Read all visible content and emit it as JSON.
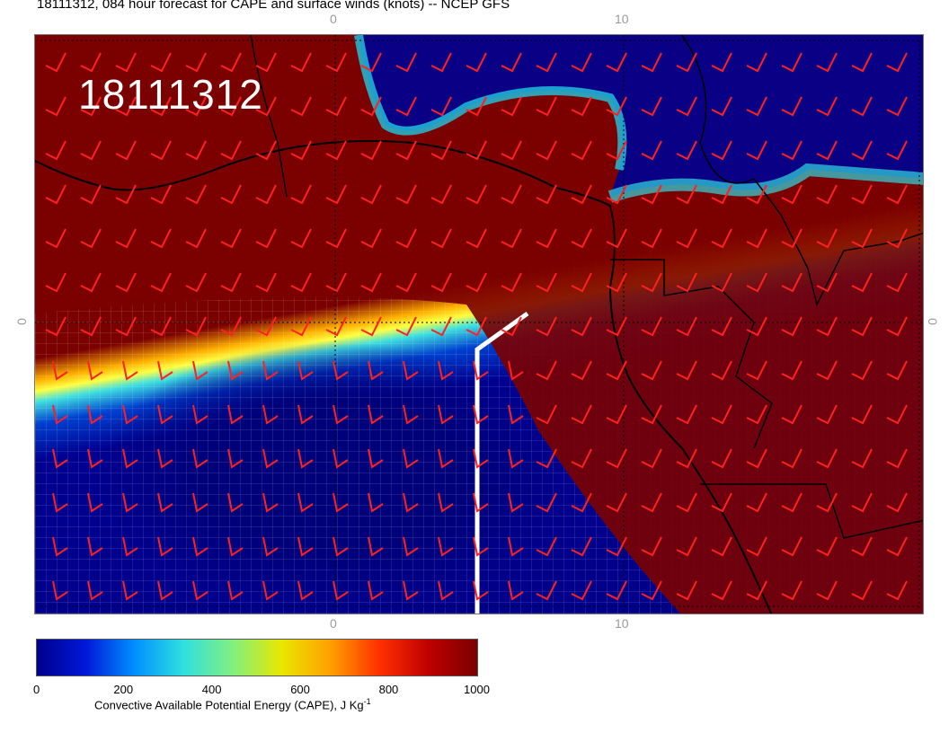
{
  "title": "18111312, 084 hour forecast for CAPE and surface winds (knots) -- NCEP GFS",
  "map": {
    "timestamp": "18111312",
    "tick_top_left": "0",
    "tick_top_right": "10",
    "tick_bottom_left": "0",
    "tick_bottom_right": "10",
    "tick_left": "0",
    "tick_right": "0"
  },
  "colorbar": {
    "ticks": [
      "0",
      "200",
      "400",
      "600",
      "800",
      "1000"
    ],
    "title": "Convective Available Potential Energy (CAPE), J Kg",
    "title_superscript": "-1",
    "colors": [
      "#00008c",
      "#0018d8",
      "#0090ff",
      "#30e0e0",
      "#80f080",
      "#e8e800",
      "#ffa000",
      "#ff3000",
      "#c00000",
      "#7b0000"
    ]
  },
  "colors": {
    "wind_barb": "#ff2020",
    "coastline": "#000000",
    "section_line": "#ffffff"
  }
}
